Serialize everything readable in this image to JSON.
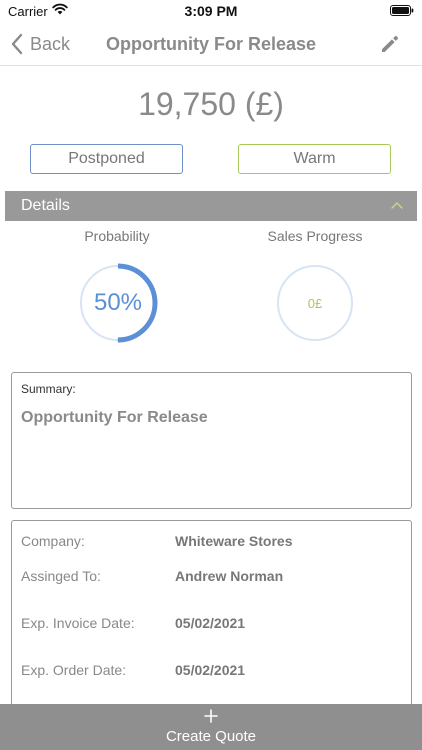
{
  "status_bar": {
    "carrier": "Carrier",
    "time": "3:09 PM"
  },
  "nav": {
    "back_label": "Back",
    "title": "Opportunity For Release"
  },
  "opportunity": {
    "amount": "19,750 (£)"
  },
  "chips": {
    "stage": "Postponed",
    "temperature": "Warm"
  },
  "details": {
    "header": "Details",
    "probability_label": "Probability",
    "probability_text": "50%",
    "probability_fraction": 0.5,
    "sales_label": "Sales Progress",
    "sales_text": "0£",
    "sales_fraction": 0
  },
  "summary": {
    "label": "Summary:",
    "text": "Opportunity For Release"
  },
  "info": {
    "company_label": "Company:",
    "company_value": "Whiteware Stores",
    "assigned_label": "Assinged To:",
    "assigned_value": "Andrew Norman",
    "invoice_label": "Exp. Invoice Date:",
    "invoice_value": "05/02/2021",
    "order_label": "Exp. Order Date:",
    "order_value": "05/02/2021"
  },
  "actions": {
    "create_quote": "Create Quote"
  },
  "colors": {
    "probability_accent": "#5b8fd6",
    "sales_accent": "#a8c95a",
    "ring_track": "#d6e4f5",
    "postponed_border": "#6f8fc9",
    "warm_border": "#a8c95a"
  }
}
